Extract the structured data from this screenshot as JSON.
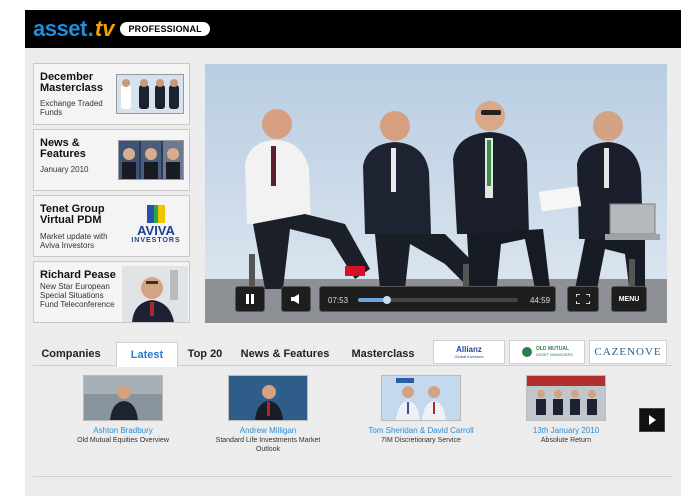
{
  "header": {
    "logo_asset": "asset",
    "logo_dot": ".",
    "logo_tv": "tv",
    "logo_badge": "PROFESSIONAL"
  },
  "promos": [
    {
      "title": "December Masterclass",
      "subtitle": "Exchange Traded Funds"
    },
    {
      "title": "News & Features",
      "subtitle": "January 2010"
    },
    {
      "title": "Tenet Group Virtual PDM",
      "subtitle": "Market update with Aviva Investors",
      "logo_text": "AVIVA",
      "logo_sub": "INVESTORS"
    },
    {
      "title": "Richard Pease",
      "subtitle": "New Star European Special Situations Fund Teleconference"
    }
  ],
  "player": {
    "current_time": "07:53",
    "duration": "44:59",
    "progress": 0.18,
    "menu_label": "MENU",
    "play_state": "playing"
  },
  "tabs": [
    {
      "label": "Companies",
      "active": false
    },
    {
      "label": "Latest",
      "active": true
    },
    {
      "label": "Top 20",
      "active": false
    },
    {
      "label": "News & Features",
      "active": false
    },
    {
      "label": "Masterclass",
      "active": false
    }
  ],
  "brands": [
    {
      "name": "Allianz",
      "sub": "Global Investors"
    },
    {
      "name": "OLD MUTUAL",
      "sub": "ASSET MANAGERS"
    },
    {
      "name": "CAZENOVE"
    }
  ],
  "videos": [
    {
      "name": "Ashton Bradbury",
      "desc": "Old Mutual Equities Overview"
    },
    {
      "name": "Andrew Milligan",
      "desc": "Standard Life Investments Market Outlook"
    },
    {
      "name": "Tom Sheridan & David Carroll",
      "desc": "7IM Discretionary Service"
    },
    {
      "name": "13th January 2010",
      "desc": "Absolute Return"
    }
  ],
  "colors": {
    "brand_blue": "#1f8fdc",
    "brand_orange": "#f0a000",
    "link_blue": "#2b8fd6"
  }
}
